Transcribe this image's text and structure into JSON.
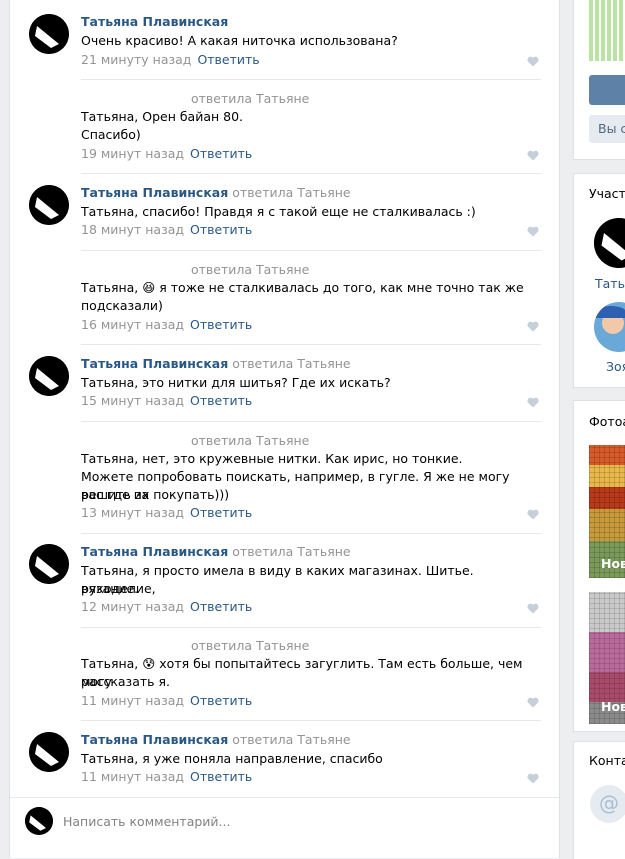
{
  "comments": [
    {
      "author": "Татьяна Плавинская",
      "reply_to": "",
      "text": "Очень красиво! А какая ниточка использована?",
      "time": "21 минуту назад",
      "reply_label": "Ответить"
    },
    {
      "author": "",
      "reply_to": "ответила Татьяне",
      "text": "Татьяна, Орен байан 80.",
      "text2": "Спасибо)",
      "time": "19 минут назад",
      "reply_label": "Ответить"
    },
    {
      "author": "Татьяна Плавинская",
      "reply_to": "ответила Татьяне",
      "text": "Татьяна, спасибо! Правдя я с такой еще не сталкивалась :)",
      "time": "18 минут назад",
      "reply_label": "Ответить"
    },
    {
      "author": "",
      "reply_to": "ответила Татьяне",
      "text_before": "Татьяна,",
      "emoji": "😆",
      "text_after": "я тоже не сталкивалась до того, как мне точно так же",
      "text2": "подсказали)",
      "time": "16 минут назад",
      "reply_label": "Ответить"
    },
    {
      "author": "Татьяна Плавинская",
      "reply_to": "ответила Татьяне",
      "text": "Татьяна, это нитки для шитья? Где их искать?",
      "time": "15 минут назад",
      "reply_label": "Ответить"
    },
    {
      "author": "",
      "reply_to": "ответила Татьяне",
      "text": "Татьяна, нет, это кружевные нитки. Как ирис, но тонкие.",
      "text2": "Можете попробовать поискать, например, в гугле. Я же не могу решить за",
      "text3": "вас где их покупать)))",
      "time": "13 минут назад",
      "reply_label": "Ответить"
    },
    {
      "author": "Татьяна Плавинская",
      "reply_to": "ответила Татьяне",
      "text": "Татьяна, я просто имела в виду в каких магазинах. Шитье. рукоделие,",
      "text2": "вязание.",
      "time": "12 минут назад",
      "reply_label": "Ответить"
    },
    {
      "author": "",
      "reply_to": "ответила Татьяне",
      "text_before": "Татьяна,",
      "emoji": "😰",
      "text_after": "хотя бы попытайтесь загуглить. Там есть больше, чем могу",
      "text2": "рассказать я.",
      "time": "11 минут назад",
      "reply_label": "Ответить"
    },
    {
      "author": "Татьяна Плавинская",
      "reply_to": "ответила Татьяне",
      "text": "Татьяна, я уже поняла направление, спасибо",
      "time": "11 минут назад",
      "reply_label": "Ответить"
    }
  ],
  "composer": {
    "placeholder": "Написать комментарий..."
  },
  "right": {
    "button_label": "Вы с",
    "members_title": "Участ",
    "member1": "Татья",
    "member2": "Зоя",
    "photos_title": "Фотоа",
    "album1": "Нов",
    "album2": "Нов",
    "contacts_title": "Конта",
    "at_symbol": "@"
  },
  "colors": {
    "link": "#2a5885",
    "muted": "#939393",
    "background": "#edeef0",
    "button": "#5e81a8"
  }
}
